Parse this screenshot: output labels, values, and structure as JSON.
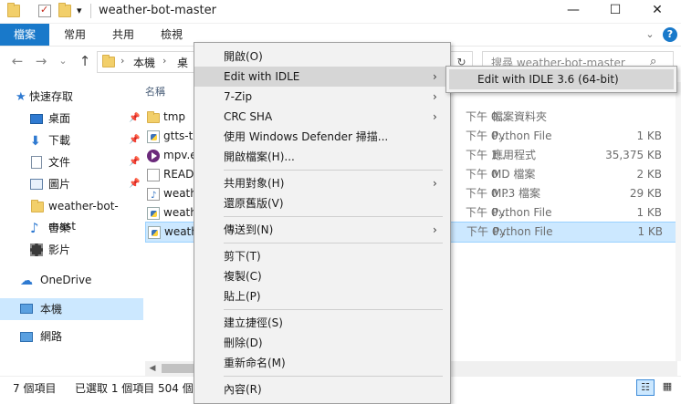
{
  "window": {
    "title": "weather-bot-master",
    "minimize_glyph": "—",
    "maximize_glyph": "☐",
    "close_glyph": "✕",
    "qat_dropdown_glyph": "▾"
  },
  "ribbon": {
    "tabs": [
      "檔案",
      "常用",
      "共用",
      "檢視"
    ],
    "expand_glyph": "⌄",
    "help_glyph": "?"
  },
  "address": {
    "back_glyph": "←",
    "forward_glyph": "→",
    "recent_glyph": "⌄",
    "up_glyph": "↑",
    "separator": "›",
    "crumbs": [
      "本機",
      "桌"
    ],
    "refresh_glyph": "↻"
  },
  "search": {
    "placeholder": "搜尋 weather-bot-master",
    "icon_glyph": "⌕"
  },
  "navpane": {
    "quick_access": "快速存取",
    "pin_glyph": "📌",
    "items": [
      {
        "label": "桌面",
        "icon": "desktop-icon"
      },
      {
        "label": "下載",
        "icon": "download-icon"
      },
      {
        "label": "文件",
        "icon": "documents-icon"
      },
      {
        "label": "圖片",
        "icon": "pictures-icon"
      },
      {
        "label": "weather-bot-mast",
        "icon": "folder-icon"
      },
      {
        "label": "音樂",
        "icon": "music-icon"
      },
      {
        "label": "影片",
        "icon": "videos-icon"
      }
    ],
    "onedrive": "OneDrive",
    "thispc": "本機",
    "network": "網路"
  },
  "content": {
    "column_name": "名稱",
    "rows": [
      {
        "name": "tmp",
        "date": "下午 0...",
        "type": "檔案資料夾",
        "size": "",
        "icon": "folder-icon"
      },
      {
        "name": "gtts-t",
        "date": "下午 0...",
        "type": "Python File",
        "size": "1 KB",
        "icon": "python-file-icon"
      },
      {
        "name": "mpv.e",
        "date": "下午 1...",
        "type": "應用程式",
        "size": "35,375 KB",
        "icon": "mpv-icon"
      },
      {
        "name": "READ",
        "date": "下午 0...",
        "type": "MD 檔案",
        "size": "2 KB",
        "icon": "text-file-icon"
      },
      {
        "name": "weath",
        "date": "下午 0...",
        "type": "MP3 檔案",
        "size": "29 KB",
        "icon": "mp3-file-icon"
      },
      {
        "name": "weath",
        "date": "下午 0...",
        "type": "Python File",
        "size": "1 KB",
        "icon": "python-file-icon"
      },
      {
        "name": "weath",
        "date": "下午 0...",
        "type": "Python File",
        "size": "1 KB",
        "icon": "python-file-icon"
      }
    ],
    "scroll_left_glyph": "◀"
  },
  "statusbar": {
    "item_count": "7 個項目",
    "selected": "已選取 1 個項目",
    "size_partial": "504 個",
    "details_view_glyph": "☷",
    "tiles_view_glyph": "▦"
  },
  "context_menu": {
    "submenu_arrow": "›",
    "items": [
      {
        "label": "開啟(O)"
      },
      {
        "label": "Edit with IDLE",
        "submenu": true
      },
      {
        "label": "7-Zip",
        "submenu": true
      },
      {
        "label": "CRC SHA",
        "submenu": true
      },
      {
        "label": "使用 Windows Defender 掃描..."
      },
      {
        "label": "開啟檔案(H)..."
      },
      {
        "label": "共用對象(H)",
        "submenu": true
      },
      {
        "label": "還原舊版(V)"
      },
      {
        "label": "傳送到(N)",
        "submenu": true
      },
      {
        "label": "剪下(T)"
      },
      {
        "label": "複製(C)"
      },
      {
        "label": "貼上(P)"
      },
      {
        "label": "建立捷徑(S)"
      },
      {
        "label": "刪除(D)"
      },
      {
        "label": "重新命名(M)"
      },
      {
        "label": "內容(R)"
      }
    ],
    "submenu_item": "Edit with IDLE 3.6 (64-bit)"
  }
}
